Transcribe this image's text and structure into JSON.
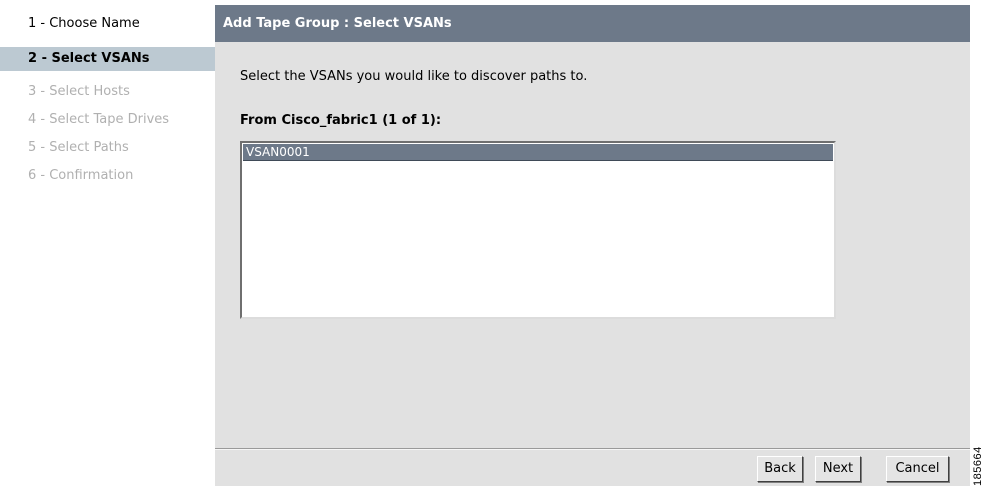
{
  "wizard_steps": [
    {
      "label": "1 - Choose Name",
      "state": "done"
    },
    {
      "label": "2 - Select VSANs",
      "state": "active"
    },
    {
      "label": "3 - Select Hosts",
      "state": "pending"
    },
    {
      "label": "4 - Select Tape Drives",
      "state": "pending"
    },
    {
      "label": "5 - Select Paths",
      "state": "pending"
    },
    {
      "label": "6 - Confirmation",
      "state": "pending"
    }
  ],
  "main": {
    "title": "Add Tape Group : Select VSANs",
    "instruction": "Select the VSANs you would like to discover paths to.",
    "fabric_heading": "From Cisco_fabric1 (1 of 1):",
    "vsan_list": [
      {
        "label": "VSAN0001",
        "selected": true
      }
    ]
  },
  "buttons": {
    "back": "Back",
    "next": "Next",
    "cancel": "Cancel"
  },
  "figure_id": "185664",
  "colors": {
    "title_bar": "#6d7989",
    "active_step": "#bcc9d2",
    "panel_background": "#e1e1e1",
    "selected_item": "#6d7989"
  }
}
